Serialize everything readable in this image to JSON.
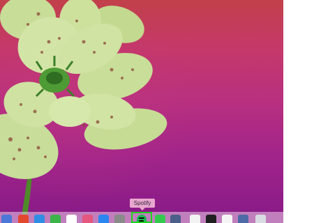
{
  "tooltip": {
    "label": "Spotify"
  },
  "dock": {
    "items": [
      {
        "icon": "finder-icon",
        "color": "#4b78d8"
      },
      {
        "icon": "chrome-icon",
        "color": "#e3482f"
      },
      {
        "icon": "safari-icon",
        "color": "#2f8de4"
      },
      {
        "icon": "facetime-icon",
        "color": "#3bb44a"
      },
      {
        "icon": "calendar-icon",
        "color": "#ffffff"
      },
      {
        "icon": "itunes-icon",
        "color": "#e6577f"
      },
      {
        "icon": "app-store-icon",
        "color": "#2a86f0"
      },
      {
        "icon": "system-preferences-icon",
        "color": "#8a8a8a"
      },
      {
        "icon": "spotify-icon",
        "color": "#1db954"
      },
      {
        "icon": "messages-icon",
        "color": "#33c94f"
      },
      {
        "icon": "screenshot-icon",
        "color": "#4b5f8a"
      },
      {
        "icon": "document-icon",
        "color": "#f2f2f2"
      },
      {
        "icon": "terminal-icon",
        "color": "#1f1f1f"
      },
      {
        "icon": "text-file-icon",
        "color": "#f5f5f5"
      },
      {
        "icon": "image-file-icon",
        "color": "#4e6aa5"
      },
      {
        "icon": "trash-icon",
        "color": "#d9dce2"
      }
    ],
    "active_app": "Spotify"
  }
}
